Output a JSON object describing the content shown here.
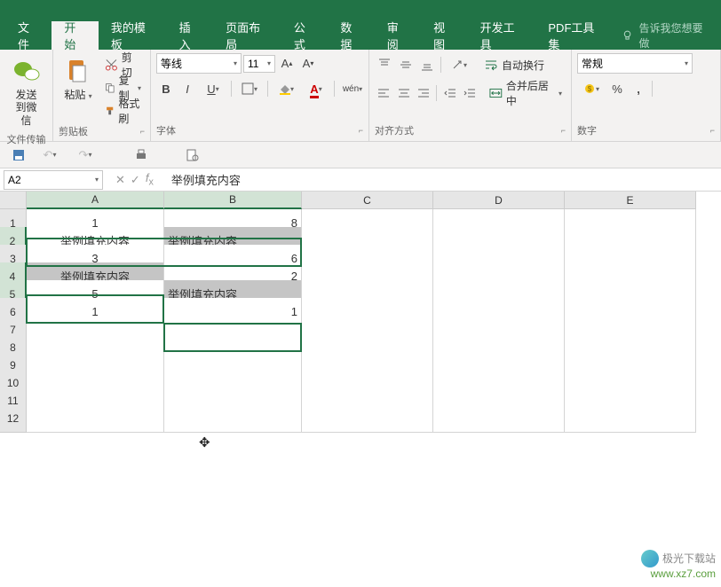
{
  "menu": {
    "file": "文件",
    "home": "开始",
    "templates": "我的模板",
    "insert": "插入",
    "layout": "页面布局",
    "formula": "公式",
    "data": "数据",
    "review": "审阅",
    "view": "视图",
    "dev": "开发工具",
    "pdf": "PDF工具集",
    "tell_me": "告诉我您想要做"
  },
  "ribbon": {
    "send_wechat": "发送\n到微信",
    "paste": "粘贴",
    "cut": "剪切",
    "copy": "复制",
    "format_painter": "格式刷",
    "group_file": "文件传输",
    "group_clipboard": "剪贴板",
    "group_font": "字体",
    "group_align": "对齐方式",
    "group_number": "数字",
    "font_name": "等线",
    "font_size": "11",
    "wrap": "自动换行",
    "merge": "合并后居中",
    "num_format": "常规"
  },
  "formula_bar": {
    "namebox": "A2",
    "value": "举例填充内容"
  },
  "columns": [
    "A",
    "B",
    "C",
    "D",
    "E"
  ],
  "rows": [
    "1",
    "2",
    "3",
    "4",
    "5",
    "6",
    "7",
    "8",
    "9",
    "10",
    "11",
    "12"
  ],
  "cells": {
    "A1": "1",
    "B1": "8",
    "A2": "举例填充内容",
    "B2": "举例填充内容",
    "A3": "3",
    "B3": "6",
    "A4": "举例填充内容",
    "B4": "2",
    "A5": "5",
    "B5": "举例填充内容",
    "A6": "1",
    "B6": "1"
  },
  "watermark": {
    "brand": "极光下载站",
    "url": "www.xz7.com"
  }
}
